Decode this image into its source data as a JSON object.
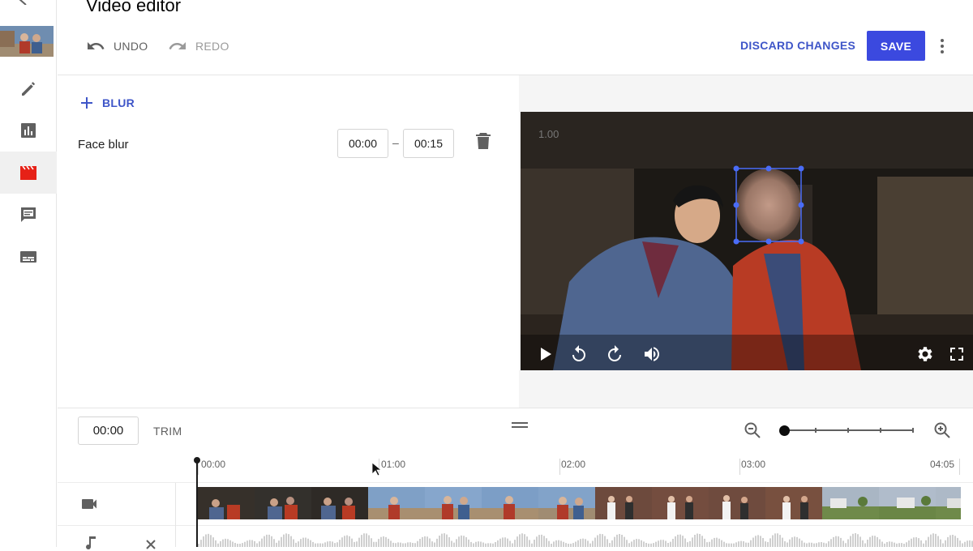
{
  "app": {
    "title": "Video editor"
  },
  "rail": {
    "items": [
      {
        "icon": "pencil-icon"
      },
      {
        "icon": "analytics-icon"
      },
      {
        "icon": "clapperboard-icon",
        "active": true
      },
      {
        "icon": "comments-icon"
      },
      {
        "icon": "subtitles-icon"
      }
    ]
  },
  "toolbar": {
    "undo_label": "UNDO",
    "redo_label": "REDO",
    "discard_label": "DISCARD CHANGES",
    "save_label": "SAVE"
  },
  "blur_panel": {
    "add_label": "BLUR",
    "items": [
      {
        "name": "Face blur",
        "start": "00:00",
        "end": "00:15"
      }
    ],
    "range_separator": "–"
  },
  "preview": {
    "overlay_time": "1.00"
  },
  "timeline": {
    "current_time": "00:00",
    "trim_label": "TRIM",
    "ruler": [
      "00:00",
      "01:00",
      "02:00",
      "03:00",
      "04:05"
    ],
    "zoom_level": 0
  },
  "colors": {
    "accent": "#3b49df",
    "link": "#3e55c8",
    "blur_handle": "#4a6cf7",
    "clapperboard": "#e62117"
  }
}
